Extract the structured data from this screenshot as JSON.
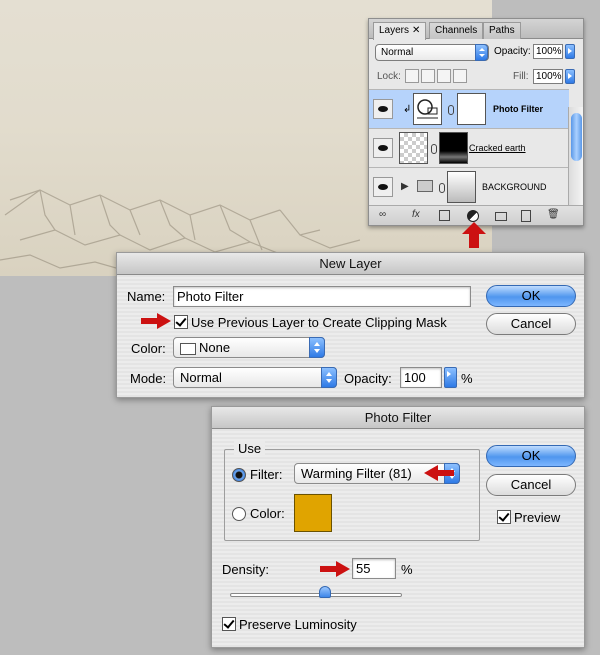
{
  "layers_panel": {
    "tabs": [
      {
        "label": "Layers",
        "close": "✕"
      },
      {
        "label": "Channels"
      },
      {
        "label": "Paths"
      }
    ],
    "blend_mode": "Normal",
    "opacity_label": "Opacity:",
    "opacity_value": "100%",
    "lock_label": "Lock:",
    "fill_label": "Fill:",
    "fill_value": "100%",
    "layers": [
      {
        "name": "Photo Filter",
        "selected": true
      },
      {
        "name": "Cracked earth",
        "selected": false
      },
      {
        "name": "BACKGROUND",
        "selected": false
      }
    ],
    "bottom_icons": [
      "link-icon",
      "fx-icon",
      "mask-icon",
      "adjustment-layer-icon",
      "group-icon",
      "new-layer-icon",
      "trash-icon"
    ],
    "fx_label": "fx"
  },
  "new_layer_dialog": {
    "title": "New Layer",
    "name_label": "Name:",
    "name_value": "Photo Filter",
    "clip_label": "Use Previous Layer to Create Clipping Mask",
    "clip_checked": true,
    "color_label": "Color:",
    "color_value": "None",
    "mode_label": "Mode:",
    "mode_value": "Normal",
    "opacity_label": "Opacity:",
    "opacity_value": "100",
    "percent": "%",
    "ok": "OK",
    "cancel": "Cancel"
  },
  "photo_filter_dialog": {
    "title": "Photo Filter",
    "use_label": "Use",
    "filter_label": "Filter:",
    "filter_value": "Warming Filter (81)",
    "color_label": "Color:",
    "swatch_color": "#e0a400",
    "density_label": "Density:",
    "density_value": "55",
    "percent": "%",
    "density_fraction": 0.55,
    "preserve_label": "Preserve Luminosity",
    "ok": "OK",
    "cancel": "Cancel",
    "preview_label": "Preview"
  },
  "colors": {
    "accent": "#2f7ae6",
    "arrow": "#cc1111",
    "swatch": "#e0a400"
  }
}
